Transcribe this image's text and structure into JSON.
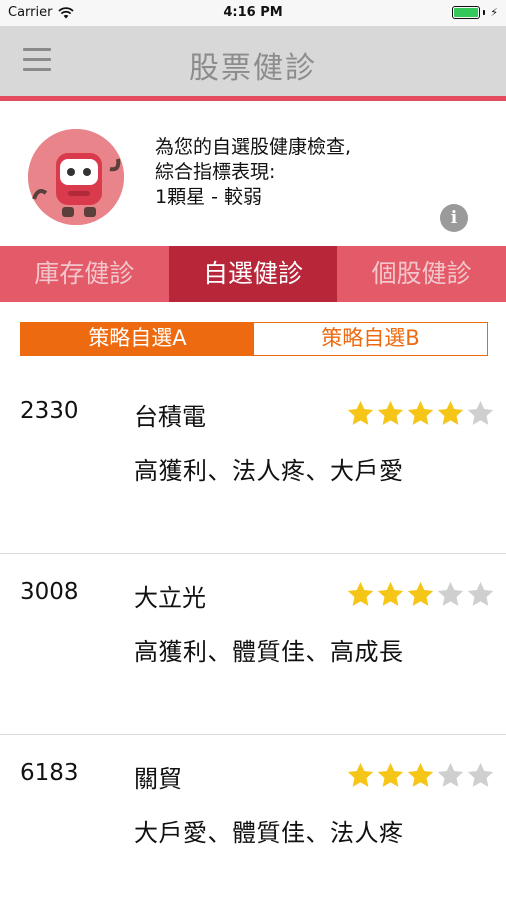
{
  "status_bar": {
    "carrier": "Carrier",
    "time": "4:16 PM"
  },
  "nav": {
    "title": "股票健診"
  },
  "summary": {
    "line1": "為您的自選股健康檢查,",
    "line2": "綜合指標表現:",
    "line3": "1顆星 - 較弱",
    "info_symbol": "i"
  },
  "tabs": [
    {
      "label": "庫存健診",
      "active": false
    },
    {
      "label": "自選健診",
      "active": true
    },
    {
      "label": "個股健診",
      "active": false
    }
  ],
  "segments": [
    {
      "label": "策略自選A",
      "active": true
    },
    {
      "label": "策略自選B",
      "active": false
    }
  ],
  "stocks": [
    {
      "code": "2330",
      "name": "台積電",
      "tags": "高獲利、法人疼、大戶愛",
      "rating": 4,
      "max_rating": 5
    },
    {
      "code": "3008",
      "name": "大立光",
      "tags": "高獲利、體質佳、高成長",
      "rating": 3,
      "max_rating": 5
    },
    {
      "code": "6183",
      "name": "關貿",
      "tags": "大戶愛、體質佳、法人疼",
      "rating": 3,
      "max_rating": 5
    }
  ],
  "colors": {
    "accent_red": "#e34c5d",
    "tab_active": "#b8263a",
    "segment_orange": "#ee6a10",
    "star_on": "#f5c518",
    "star_off": "#cfcfcf"
  }
}
